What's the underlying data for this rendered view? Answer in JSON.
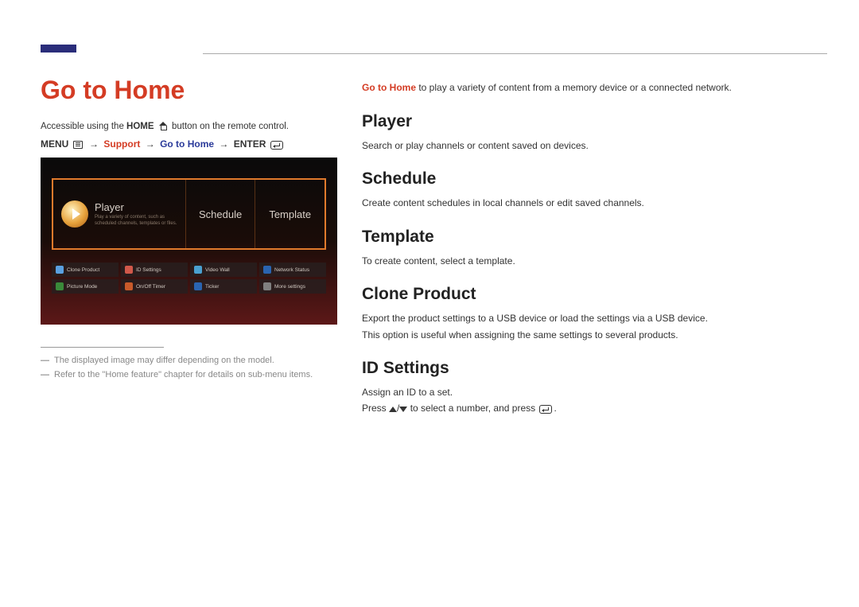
{
  "title": "Go to Home",
  "intro": {
    "prefix": "Accessible using the ",
    "homeWord": "HOME",
    "suffix": " button on the remote control."
  },
  "breadcrumb": {
    "menu": "MENU",
    "support": "Support",
    "goto": "Go to Home",
    "enter": "ENTER"
  },
  "screenshot": {
    "player": {
      "label": "Player",
      "sub": "Play a variety of content, such as scheduled channels, templates or files."
    },
    "schedule": "Schedule",
    "template": "Template",
    "mini": [
      {
        "label": "Clone Product",
        "color": "#5aa0e0"
      },
      {
        "label": "ID Settings",
        "color": "#d0584a"
      },
      {
        "label": "Video Wall",
        "color": "#4aa0d0"
      },
      {
        "label": "Network Status",
        "color": "#2a64b0"
      },
      {
        "label": "Picture Mode",
        "color": "#3a8a3a"
      },
      {
        "label": "On/Off Timer",
        "color": "#c85a2a"
      },
      {
        "label": "Ticker",
        "color": "#2a64b0"
      },
      {
        "label": "More settings",
        "color": "#808080"
      }
    ]
  },
  "footnotes": [
    "The displayed image may differ depending on the model.",
    "Refer to the \"Home feature\" chapter for details on sub-menu items."
  ],
  "rightTop": {
    "goto": "Go to Home",
    "rest": " to play a variety of content from a memory device or a connected network."
  },
  "sections": {
    "player": {
      "heading": "Player",
      "body": "Search or play channels or content saved on devices."
    },
    "schedule": {
      "heading": "Schedule",
      "body": "Create content schedules in local channels or edit saved channels."
    },
    "template": {
      "heading": "Template",
      "body": "To create content, select a template."
    },
    "cloneProduct": {
      "heading": "Clone Product",
      "body1": "Export the product settings to a USB device or load the settings via a USB device.",
      "body2": "This option is useful when assigning the same settings to several products."
    },
    "idSettings": {
      "heading": "ID Settings",
      "body1": "Assign an ID to a set.",
      "pressPrefix": "Press ",
      "pressMid": " to select a number, and press ",
      "pressSuffix": "."
    }
  }
}
